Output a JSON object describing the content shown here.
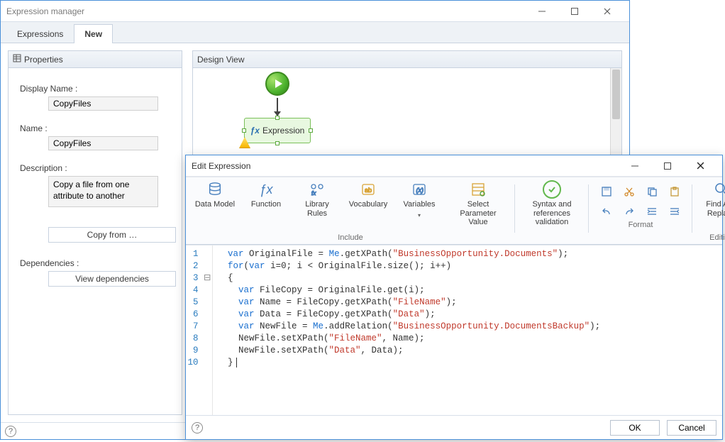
{
  "outer": {
    "title": "Expression manager",
    "tabs": [
      {
        "label": "Expressions",
        "active": false
      },
      {
        "label": "New",
        "active": true
      }
    ]
  },
  "properties": {
    "panel_title": "Properties",
    "display_name_label": "Display Name :",
    "display_name_value": "CopyFiles",
    "name_label": "Name :",
    "name_value": "CopyFiles",
    "description_label": "Description :",
    "description_value": "Copy a file from one attribute to another",
    "copy_from_btn": "Copy from …",
    "dependencies_label": "Dependencies :",
    "view_deps_btn": "View dependencies"
  },
  "design": {
    "panel_title": "Design View",
    "expression_node_label": "Expression"
  },
  "edit": {
    "title": "Edit Expression",
    "ribbon": {
      "include_caption": "Include",
      "format_caption": "Format",
      "editing_caption": "Editing",
      "data_model": "Data Model",
      "function": "Function",
      "library_rules": "Library Rules",
      "vocabulary": "Vocabulary",
      "variables": "Variables",
      "select_param_value": "Select Parameter Value",
      "syntax_validation": "Syntax and references validation",
      "find_replace": "Find And Replace"
    },
    "code_lines": [
      {
        "n": 1,
        "t": "  var OriginalFile = Me.getXPath(\"BusinessOpportunity.Documents\");"
      },
      {
        "n": 2,
        "t": "  for(var i=0; i < OriginalFile.size(); i++)"
      },
      {
        "n": 3,
        "t": "  {"
      },
      {
        "n": 4,
        "t": "    var FileCopy = OriginalFile.get(i);"
      },
      {
        "n": 5,
        "t": "    var Name = FileCopy.getXPath(\"FileName\");"
      },
      {
        "n": 6,
        "t": "    var Data = FileCopy.getXPath(\"Data\");"
      },
      {
        "n": 7,
        "t": "    var NewFile = Me.addRelation(\"BusinessOpportunity.DocumentsBackup\");"
      },
      {
        "n": 8,
        "t": "    NewFile.setXPath(\"FileName\", Name);"
      },
      {
        "n": 9,
        "t": "    NewFile.setXPath(\"Data\", Data);"
      },
      {
        "n": 10,
        "t": "  }"
      }
    ],
    "ok_btn": "OK",
    "cancel_btn": "Cancel"
  }
}
